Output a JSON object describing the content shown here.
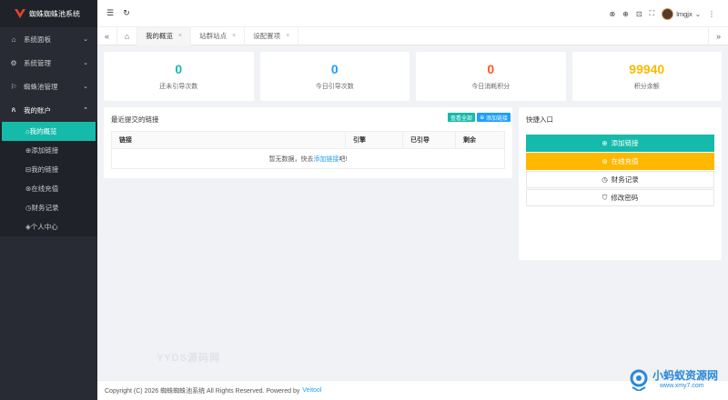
{
  "app": {
    "title": "蜘蛛蜘蛛池系统"
  },
  "sidebar": {
    "items": [
      {
        "label": "系统面板",
        "icon": "home-icon"
      },
      {
        "label": "系统管理",
        "icon": "gear-icon"
      },
      {
        "label": "蜘蛛池管理",
        "icon": "flag-icon"
      },
      {
        "label": "我的账户",
        "icon": "user-icon"
      }
    ],
    "subitems": [
      {
        "label": "我的概览",
        "icon": "home-icon"
      },
      {
        "label": "添加链接",
        "icon": "add-icon"
      },
      {
        "label": "我的链接",
        "icon": "link-icon"
      },
      {
        "label": "在线充值",
        "icon": "recharge-icon"
      },
      {
        "label": "财务记录",
        "icon": "record-icon"
      },
      {
        "label": "个人中心",
        "icon": "profile-icon"
      }
    ]
  },
  "topbar": {
    "username": "lmgjx"
  },
  "tabs": [
    {
      "label": "我的概览"
    },
    {
      "label": "站群站点"
    },
    {
      "label": "设配置项"
    }
  ],
  "stats": [
    {
      "value": "0",
      "label": "还未引导次数",
      "color": "#16baaa"
    },
    {
      "value": "0",
      "label": "今日引导次数",
      "color": "#1e9fff"
    },
    {
      "value": "0",
      "label": "今日消耗积分",
      "color": "#ff5722"
    },
    {
      "value": "99940",
      "label": "积分余额",
      "color": "#ffb800"
    }
  ],
  "recent": {
    "title": "最近提交的链接",
    "view_all": "查看全部",
    "add_link": "添加链接",
    "columns": [
      "链接",
      "引擎",
      "已引导",
      "剩余"
    ],
    "empty_prefix": "暂无数据，快去",
    "empty_link": "添加链接",
    "empty_suffix": "吧!"
  },
  "quick": {
    "title": "快捷入口",
    "buttons": [
      {
        "label": "添加链接",
        "icon": "add-circle-icon"
      },
      {
        "label": "在线充值",
        "icon": "recharge-icon"
      },
      {
        "label": "财务记录",
        "icon": "clock-icon"
      },
      {
        "label": "修改密码",
        "icon": "shield-icon"
      }
    ]
  },
  "footer": {
    "text": "Copyright (C) 2026 蜘蛛蜘蛛池系统 All Rights Reserved. Powered by",
    "link": "Veitool"
  },
  "watermarks": {
    "yyds": "YYDS源码网",
    "site_name": "小蚂蚁资源网",
    "site_url": "www.xmy7.com"
  },
  "colors": {
    "accent": "#16baaa",
    "blue": "#1e9fff",
    "orange": "#ff5722",
    "yellow": "#ffb800",
    "sidebar_bg": "#282b33"
  }
}
